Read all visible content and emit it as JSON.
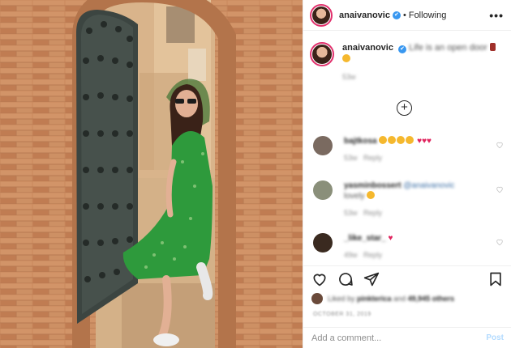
{
  "post": {
    "author": "anaivanovic",
    "separator": "•",
    "follow_status": "Following",
    "more_icon": "more-horizontal-icon",
    "verified_glyph": "✔"
  },
  "caption": {
    "username": "anaivanovic",
    "text": "Life is an open door",
    "time": "53w"
  },
  "load_more_glyph": "+",
  "comments": [
    {
      "username": "bajtkosa",
      "text": "",
      "time": "53w",
      "reply": "Reply",
      "avatar_color": "#7a6a60",
      "emojis": [
        "#f5b82e",
        "#f5b82e",
        "#f5b82e",
        "#f5b82e"
      ],
      "hearts": [
        "♥",
        "♥",
        "♥"
      ]
    },
    {
      "username": "yasminbossert",
      "mention": "@anaivanovic",
      "text": "lovely",
      "time": "53w",
      "reply": "Reply",
      "avatar_color": "#8a8f7a",
      "emojis": [
        "#f5b82e"
      ],
      "hearts": []
    },
    {
      "username": "_like_star_",
      "text": "",
      "time": "49w",
      "reply": "Reply",
      "avatar_color": "#3a2a20",
      "emojis": [],
      "hearts": [
        "♥"
      ]
    }
  ],
  "actions": {
    "like_icon": "heart-outline-icon",
    "comment_icon": "comment-bubble-icon",
    "share_icon": "paper-plane-icon",
    "save_icon": "bookmark-icon"
  },
  "likes": {
    "prefix": "Liked by",
    "user": "pinkterica",
    "middle": "and",
    "count": "49,945 others"
  },
  "date": "OCTOBER 31, 2019",
  "add_comment": {
    "placeholder": "Add a comment...",
    "post_label": "Post"
  },
  "colors": {
    "verified": "#3897f0",
    "mention": "#00376b",
    "heart": "#e0245e",
    "post_disabled": "#b3dbff",
    "brick": "#c8875a",
    "dress": "#2e9a3c"
  }
}
